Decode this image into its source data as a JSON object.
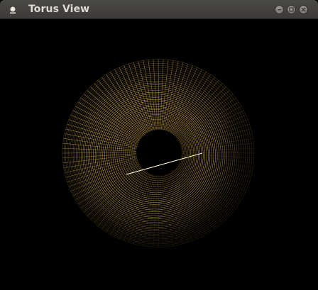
{
  "window": {
    "title": "Torus View",
    "icon": "app-dot-icon"
  },
  "controls": {
    "minimize_icon": "minimize-icon",
    "maximize_icon": "maximize-icon",
    "close_icon": "close-icon"
  },
  "scene": {
    "background_color": "#000000",
    "wire_color": "#d2a848",
    "highlight_color": "#fff6d8",
    "shape": "torus-wireframe"
  }
}
